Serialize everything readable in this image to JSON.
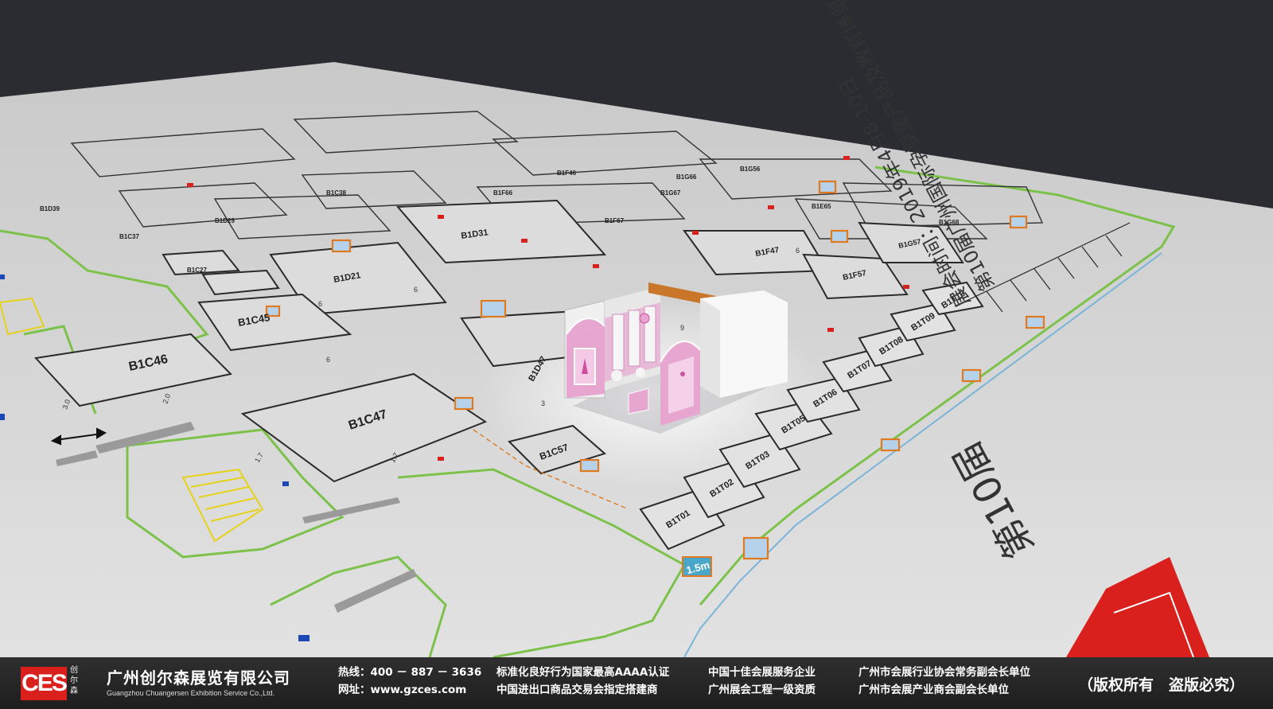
{
  "scene": {
    "booths_back": [
      "B1D39",
      "B1D29",
      "B1C37",
      "B1C38",
      "B1F66",
      "B1F67",
      "B1G67",
      "B1F46",
      "B1G66",
      "B1G56",
      "B1E65",
      "B1G68"
    ],
    "booths_main": [
      "B1D31",
      "B1D21",
      "B1C27",
      "B1C45",
      "B1C46",
      "B1C47",
      "B1C57",
      "B1D47",
      "B1F47",
      "B1F57",
      "B1G57"
    ],
    "booths_row": [
      "B1T01",
      "B1T02",
      "B1T03",
      "B1T05",
      "B1T06",
      "B1T07",
      "B1T08",
      "B1T09",
      "B1T10"
    ],
    "dimension_numbers": [
      "6",
      "6",
      "6",
      "6",
      "6",
      "6",
      "3",
      "9",
      "1.7",
      "1.7",
      "3.0",
      "2.0"
    ],
    "scale_badge": "1.5m",
    "banner_title": "第10届广州国际孕婴童产品及教育博览会",
    "banner_date": "展会时间：2019年4月8-10日",
    "banner_big": "第10届",
    "colors": {
      "floor": "#d8d8d8",
      "walls_green": "#7cc24a",
      "accent_orange": "#e07a20",
      "booth_pink": "#e7a6d0",
      "logo_red": "#d9201c"
    }
  },
  "footer": {
    "logo_letters": "CES",
    "logo_side": "创尔森",
    "company_name": "广州创尔森展览有限公司",
    "company_name_en": "Guangzhou Chuangersen Exhibition Service Co.,Ltd.",
    "hotline": "热线：400 － 887 － 3636",
    "website": "网址：www.gzces.com",
    "cert_1": "标准化良好行为国家最高AAAA认证",
    "cert_2": "中国进出口商品交易会指定搭建商",
    "award_1": "中国十佳会展服务企业",
    "award_2": "广州展会工程一级资质",
    "assoc_1": "广州市会展行业协会常务副会长单位",
    "assoc_2": "广州市会展产业商会副会长单位",
    "copyright": "（版权所有　盗版必究）"
  }
}
